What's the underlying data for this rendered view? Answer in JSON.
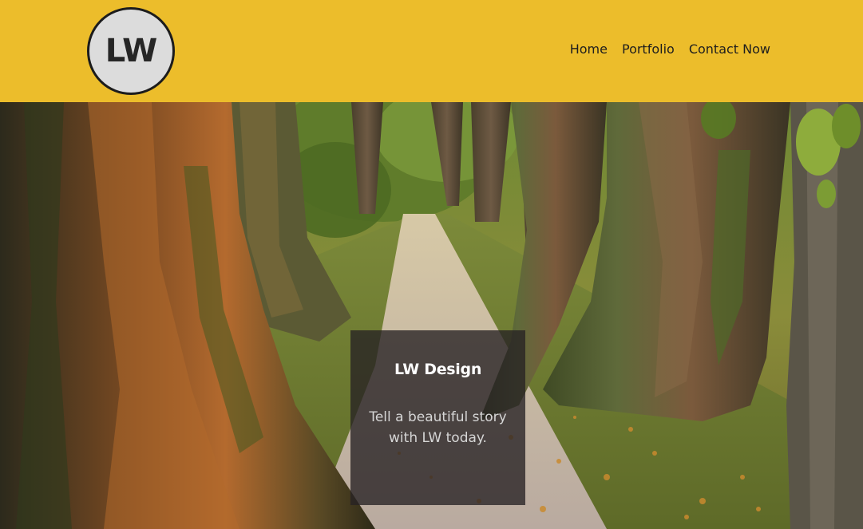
{
  "header": {
    "logo_text": "LW",
    "background_color": "#ecbd2b"
  },
  "nav": {
    "items": [
      {
        "label": "Home"
      },
      {
        "label": "Portfolio"
      },
      {
        "label": "Contact Now"
      }
    ]
  },
  "hero": {
    "image_subject": "tree-lined forest path",
    "card": {
      "title": "LW Design",
      "text": "Tell a beautiful story with LW today."
    }
  }
}
